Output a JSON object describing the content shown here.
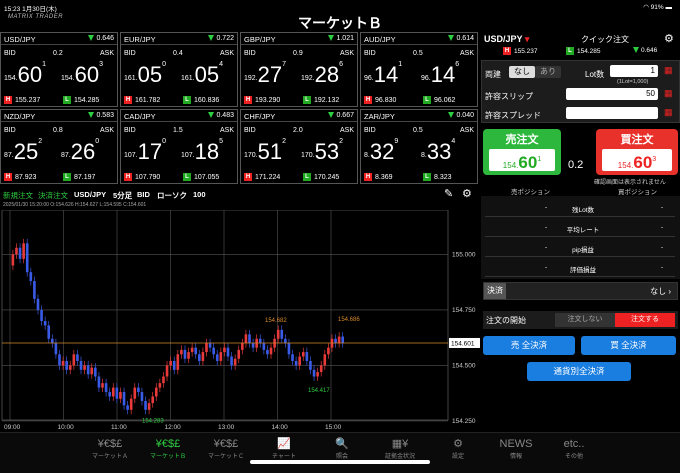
{
  "status": {
    "time": "15:23",
    "date": "1月30日(木)",
    "battery": "91%"
  },
  "app": {
    "logo": "MATRIX TRADER",
    "title": "マーケットＢ"
  },
  "tiles": [
    {
      "pair": "USD/JPY",
      "change": "0.646",
      "spread": "0.2",
      "bid_pre": "154.",
      "bid_big": "60",
      "bid_sup": "1",
      "ask_pre": "154.",
      "ask_big": "60",
      "ask_sup": "3",
      "high": "155.237",
      "low": "154.285"
    },
    {
      "pair": "EUR/JPY",
      "change": "0.722",
      "spread": "0.4",
      "bid_pre": "161.",
      "bid_big": "05",
      "bid_sup": "0",
      "ask_pre": "161.",
      "ask_big": "05",
      "ask_sup": "4",
      "high": "161.782",
      "low": "160.836"
    },
    {
      "pair": "GBP/JPY",
      "change": "1.021",
      "spread": "0.9",
      "bid_pre": "192.",
      "bid_big": "27",
      "bid_sup": "7",
      "ask_pre": "192.",
      "ask_big": "28",
      "ask_sup": "6",
      "high": "193.290",
      "low": "192.132"
    },
    {
      "pair": "AUD/JPY",
      "change": "0.614",
      "spread": "0.5",
      "bid_pre": "96.",
      "bid_big": "14",
      "bid_sup": "1",
      "ask_pre": "96.",
      "ask_big": "14",
      "ask_sup": "6",
      "high": "96.830",
      "low": "96.062"
    },
    {
      "pair": "NZD/JPY",
      "change": "0.583",
      "spread": "0.8",
      "bid_pre": "87.",
      "bid_big": "25",
      "bid_sup": "2",
      "ask_pre": "87.",
      "ask_big": "26",
      "ask_sup": "0",
      "high": "87.923",
      "low": "87.197"
    },
    {
      "pair": "CAD/JPY",
      "change": "0.483",
      "spread": "1.5",
      "bid_pre": "107.",
      "bid_big": "17",
      "bid_sup": "0",
      "ask_pre": "107.",
      "ask_big": "18",
      "ask_sup": "5",
      "high": "107.790",
      "low": "107.055"
    },
    {
      "pair": "CHF/JPY",
      "change": "0.667",
      "spread": "2.0",
      "bid_pre": "170.",
      "bid_big": "51",
      "bid_sup": "2",
      "ask_pre": "170.",
      "ask_big": "53",
      "ask_sup": "2",
      "high": "171.224",
      "low": "170.245"
    },
    {
      "pair": "ZAR/JPY",
      "change": "0.040",
      "spread": "0.5",
      "bid_pre": "8.",
      "bid_big": "32",
      "bid_sup": "9",
      "ask_pre": "8.",
      "ask_big": "33",
      "ask_sup": "4",
      "high": "8.369",
      "low": "8.323"
    }
  ],
  "labels": {
    "bid": "BID",
    "ask": "ASK",
    "h": "H",
    "l": "L"
  },
  "chart": {
    "tab_new": "新規注文",
    "tab_settle": "決済注文",
    "pair": "USD/JPY",
    "interval": "5分足",
    "side": "BID",
    "type": "ローソク",
    "count": "100",
    "ohlc": "2025/01/30 15:20:00  O:154.626  H:154.627  L:154.595  C:154.601",
    "y_ticks": [
      "155.000",
      "154.750",
      "154.500",
      "154.250"
    ],
    "x_ticks": [
      "09:00",
      "10:00",
      "11:00",
      "12:00",
      "13:00",
      "14:00",
      "15:00"
    ],
    "last": "154.601",
    "ann_high1": "154.682",
    "ann_high2": "154.686",
    "ann_low1": "154.283",
    "ann_low2": "154.417"
  },
  "panel": {
    "pair": "USD/JPY",
    "quick": "クイック注文",
    "high": "155.237",
    "low": "154.285",
    "change": "0.646",
    "both_label": "両建",
    "both_off": "なし",
    "both_on": "あり",
    "lot_label": "Lot数",
    "lot_value": "1",
    "lot_note": "(1Lot=1,000)",
    "slip_label": "許容スリップ",
    "slip_value": "50",
    "spread_label": "許容スプレッド",
    "spread_value": "",
    "sell_title": "売注文",
    "sell_pre": "154.",
    "sell_big": "60",
    "sell_sup": "1",
    "buy_title": "買注文",
    "buy_pre": "154.",
    "buy_big": "60",
    "buy_sup": "3",
    "spread": "0.2",
    "confirm_note": "確認画面は表示されません",
    "sell_pos": "売ポジション",
    "buy_pos": "買ポジション",
    "rows": [
      "残Lot数",
      "平均レート",
      "pip損益",
      "評価損益"
    ],
    "dash": "-",
    "settle_label": "決済",
    "settle_value": "なし",
    "order_start": "注文の開始",
    "no_order": "注文しない",
    "do_order": "注文する",
    "sell_all": "売 全決済",
    "buy_all": "買 全決済",
    "ccy_all": "通貨別全決済"
  },
  "nav": [
    {
      "icon": "¥€$£",
      "label": "マーケットＡ"
    },
    {
      "icon": "¥€$£",
      "label": "マーケットＢ"
    },
    {
      "icon": "¥€$£",
      "label": "マーケットＣ"
    },
    {
      "icon": "📈",
      "label": "チャート"
    },
    {
      "icon": "🔍",
      "label": "照会"
    },
    {
      "icon": "▦¥",
      "label": "証拠金状況"
    },
    {
      "icon": "⚙",
      "label": "設定"
    },
    {
      "icon": "NEWS",
      "label": "情報"
    },
    {
      "icon": "etc..",
      "label": "その他"
    }
  ]
}
